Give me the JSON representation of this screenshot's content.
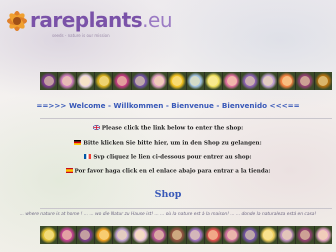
{
  "logo": {
    "text_main": "rareplants",
    "text_tld": ".eu",
    "subtitle": "seeds - nature is our mission"
  },
  "welcome": "==>>> Welcome - Willkommen - Bienvenue - Bienvenido <<<==",
  "languages": [
    {
      "flag": "uk-flag-icon",
      "text": "Please click the link below to enter the shop:"
    },
    {
      "flag": "de-flag-icon",
      "text": "Bitte klicken Sie bitte hier, um in den Shop zu gelangen:"
    },
    {
      "flag": "fr-flag-icon",
      "text": "Svp cliquez le lien ci-dessous pour entrer au shop:"
    },
    {
      "flag": "es-flag-icon",
      "text": "Por favor haga click en el enlace abajo para entrar a la tienda:"
    }
  ],
  "shop_link": "Shop",
  "tagline": "... where nature is at home ! ... ... wo die Natur zu Hause ist! ... ... où la nature est à la maison! ... ... donde la naturaleza está en casa!",
  "colors": {
    "welcome": "#3858b8",
    "shop": "#3858b8",
    "logo": "#7a52a8"
  },
  "flowers_top": [
    "#7a3a8a",
    "#c97ab8",
    "#e8d0e0",
    "#d8b020",
    "#c03a80",
    "#7050a0",
    "#e0a0c0",
    "#f0c020",
    "#a0c0e0",
    "#f0e060",
    "#e070a0",
    "#8a60b0",
    "#c0a0d0",
    "#f08040",
    "#904070",
    "#b07010"
  ],
  "flowers_bottom": [
    "#e0c030",
    "#c04090",
    "#7a3a8a",
    "#f0a020",
    "#c0a0d0",
    "#e8c0d8",
    "#b05090",
    "#905040",
    "#a070c0",
    "#e05050",
    "#d070a0",
    "#7050a0",
    "#f0d060",
    "#c090c0",
    "#904070",
    "#e0a0c0"
  ]
}
